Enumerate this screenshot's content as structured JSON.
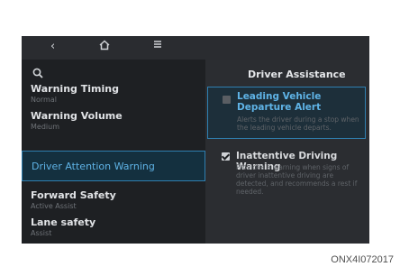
{
  "nav": {
    "back_icon": "back-arrow-icon",
    "home_icon": "home-icon",
    "menu_icon": "menu-icon"
  },
  "left": {
    "search_icon": "search-icon",
    "items": [
      {
        "label": "Warning Timing",
        "sub": "Normal"
      },
      {
        "label": "Warning Volume",
        "sub": "Medium"
      },
      {
        "label": "Driver Attention Warning",
        "sub": ""
      },
      {
        "label": "Forward Safety",
        "sub": "Active Assist"
      },
      {
        "label": "Lane safety",
        "sub": "Assist"
      }
    ]
  },
  "right": {
    "title": "Driver Assistance",
    "options": [
      {
        "title": "Leading Vehicle Departure Alert",
        "desc": "Alerts the driver during a stop when the leading vehicle departs.",
        "checked": false
      },
      {
        "title": "Inattentive Driving Warning",
        "desc": "Provides a warning when signs of driver inattentive driving are detected, and recommends a rest if needed.",
        "checked": true
      }
    ]
  },
  "caption": "ONX4I072017",
  "colors": {
    "accent": "#5fb3e6",
    "selected_border": "#2f7fb0",
    "screen_bg": "#1d1f22"
  }
}
